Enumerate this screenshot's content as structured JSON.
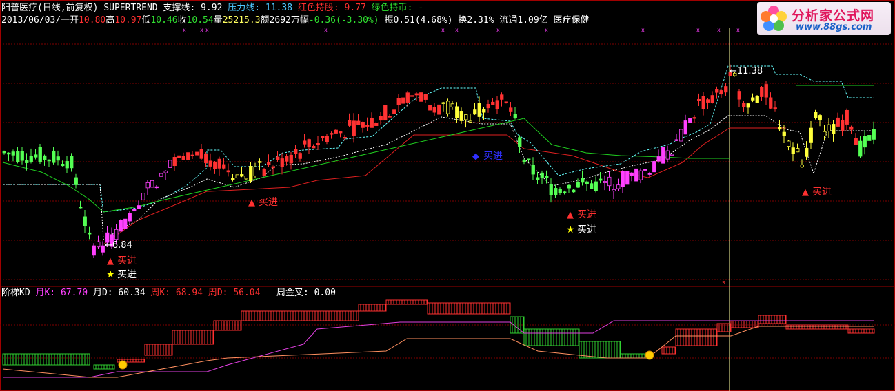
{
  "header": {
    "security_name": "阳普医疗",
    "period": "(日线,前复权)",
    "indicator": "SUPERTREND",
    "support_label": "支撑线:",
    "support_value": "9.92",
    "pressure_label": "压力线:",
    "pressure_value": "11.38",
    "red_hold_label": "红色持股:",
    "red_hold_value": "9.77",
    "green_hold_label": "绿色持币:",
    "green_hold_value": "-"
  },
  "quote": {
    "date": "2013/06/03/一",
    "open_label": "开",
    "open": "10.80",
    "high_label": "高",
    "high": "10.97",
    "low_label": "低",
    "low": "10.46",
    "close_label": "收",
    "close": "10.54",
    "volume_label": "量",
    "volume": "25215.3",
    "amount_label": "额",
    "amount": "2692万",
    "change_label": "幅",
    "change": "-0.36(-3.30%)",
    "amplitude_label": "振",
    "amplitude": "0.51(4.68%)",
    "turnover_label": "换",
    "turnover": "2.31%",
    "float_label": "流通",
    "float": "1.09亿",
    "sector": "医疗保健"
  },
  "sub_indicator": {
    "name": "阶梯KD",
    "mk_label": "月K:",
    "mk": "67.70",
    "md_label": "月D:",
    "md": "60.34",
    "wk_label": "周K:",
    "wk": "68.94",
    "wd_label": "周D:",
    "wd": "56.04",
    "cross_label": "周金叉:",
    "cross": "0.00"
  },
  "annotations": {
    "low_price": "6.84",
    "high_price": "11.38",
    "buy_text": "买进",
    "period_marker": "s"
  },
  "logo": {
    "title": "分析家公式网",
    "url": "www.88gs.com"
  },
  "colors": {
    "background": "#000000",
    "grid": "#800000",
    "up_candle": "#ff3232",
    "down_candle": "#54ff54",
    "magenta_candle": "#ff40ff",
    "yellow_candle": "#ffff3c",
    "support_line": "#e02020",
    "pressure_line": "#6ff",
    "green_line": "#20d020",
    "kd_red": "#ff3030",
    "kd_green": "#30d030",
    "kd_magenta": "#e040e0",
    "kd_orange": "#ff9060",
    "buy_text": "#ff3030",
    "blue_signal": "#3030ff",
    "star": "#ffff00",
    "cursor": "#ffffa0"
  }
}
